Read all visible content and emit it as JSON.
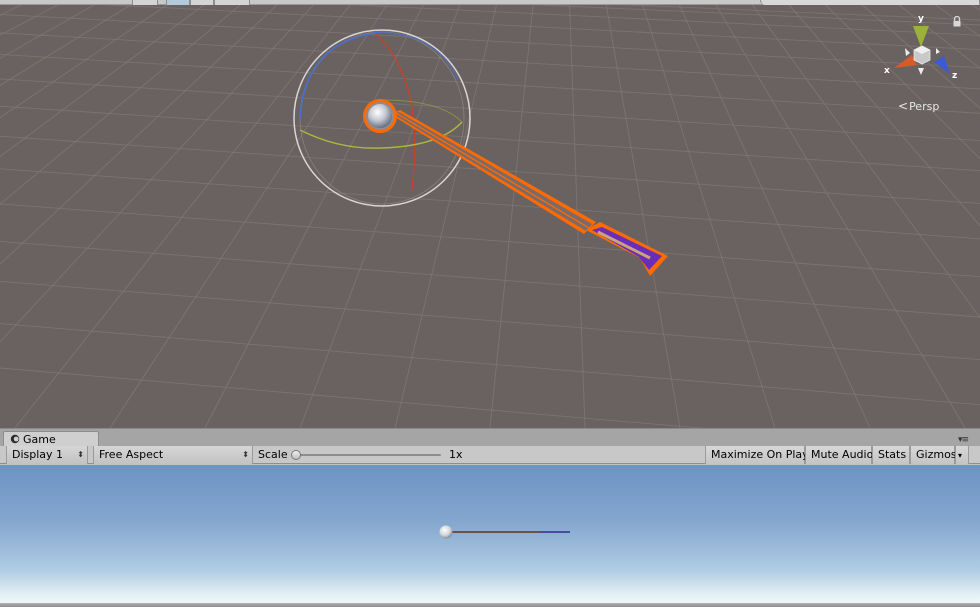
{
  "scene_view": {
    "camera_mode": "Persp",
    "axis_labels": {
      "x": "x",
      "y": "y",
      "z": "z"
    },
    "icons": [
      "lock-icon",
      "orientation-gizmo",
      "persp-chevron-icon"
    ],
    "colors": {
      "background": "#6a6260",
      "grid": "#7f7a77",
      "selection_outline": "#ff6a00",
      "arrow_fletching": "#6a2db8",
      "gizmo_x": "#d75a2a",
      "gizmo_y": "#9cb13b",
      "gizmo_z": "#3c5ad6"
    }
  },
  "game_panel": {
    "tab": {
      "label": "Game",
      "icon": "game-controller-icon"
    },
    "toolbar": {
      "display": "Display 1",
      "aspect": "Free Aspect",
      "scale_label": "Scale",
      "scale_value": "1x",
      "maximize_on_play": "Maximize On Play",
      "mute_audio": "Mute Audio",
      "stats": "Stats",
      "gizmos": "Gizmos"
    },
    "colors": {
      "sky_top": "#6d93c3",
      "horizon": "#f5f8f9"
    }
  }
}
